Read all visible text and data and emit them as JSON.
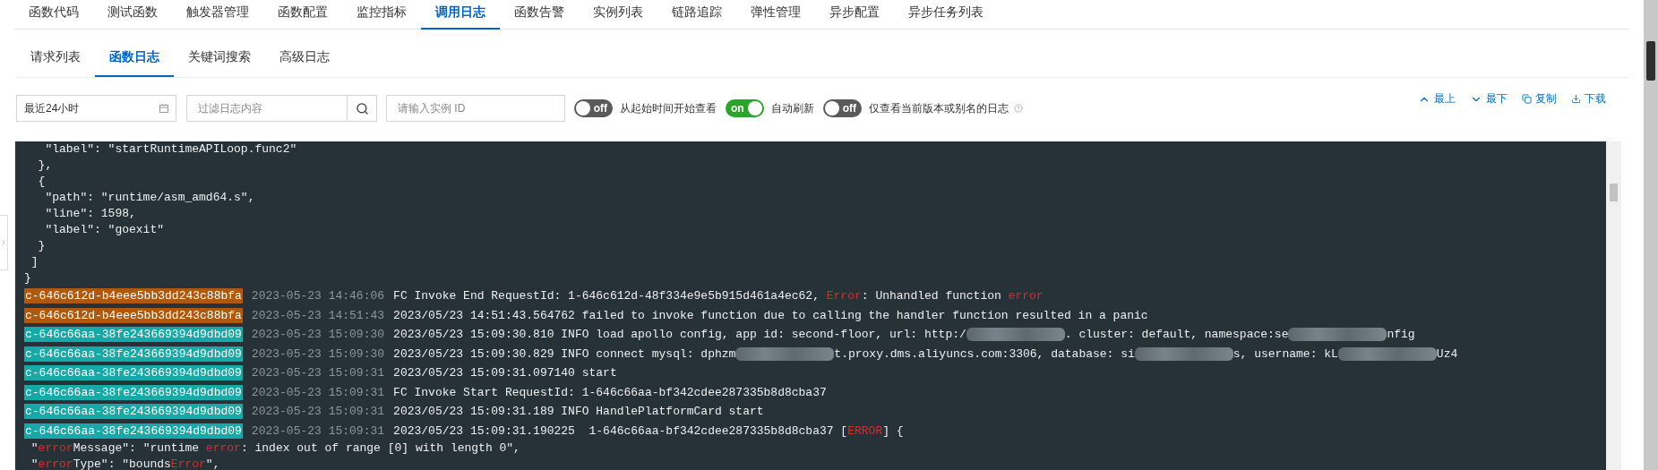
{
  "tabs": [
    {
      "label": "函数代码",
      "selected": false
    },
    {
      "label": "测试函数",
      "selected": false
    },
    {
      "label": "触发器管理",
      "selected": false
    },
    {
      "label": "函数配置",
      "selected": false
    },
    {
      "label": "监控指标",
      "selected": false
    },
    {
      "label": "调用日志",
      "selected": true
    },
    {
      "label": "函数告警",
      "selected": false
    },
    {
      "label": "实例列表",
      "selected": false
    },
    {
      "label": "链路追踪",
      "selected": false
    },
    {
      "label": "弹性管理",
      "selected": false
    },
    {
      "label": "异步配置",
      "selected": false
    },
    {
      "label": "异步任务列表",
      "selected": false
    }
  ],
  "sub_tabs": [
    {
      "label": "请求列表",
      "selected": false
    },
    {
      "label": "函数日志",
      "selected": true
    },
    {
      "label": "关键词搜索",
      "selected": false
    },
    {
      "label": "高级日志",
      "selected": false
    }
  ],
  "toolbar": {
    "time_range": "最近24小时",
    "filter": {
      "placeholder": "过滤日志内容"
    },
    "instance": {
      "placeholder": "请输入实例 ID"
    },
    "toggles": [
      {
        "text": "off",
        "on": false,
        "label": "从起始时间开始查看",
        "help": false
      },
      {
        "text": "on",
        "on": true,
        "label": "自动刷新",
        "help": false
      },
      {
        "text": "off",
        "on": false,
        "label": "仅查看当前版本或别名的日志",
        "help": true
      }
    ],
    "actions": [
      {
        "kind": "top",
        "label": "最上"
      },
      {
        "kind": "bottom",
        "label": "最下"
      },
      {
        "kind": "copy",
        "label": "复制"
      },
      {
        "kind": "download",
        "label": "下载"
      }
    ]
  },
  "log": [
    {
      "kind": "json",
      "parts": [
        {
          "kind": "text",
          "text": "   \"label\": \"startRuntimeAPILoop.func2\""
        }
      ]
    },
    {
      "kind": "json",
      "parts": [
        {
          "kind": "text",
          "text": "  },"
        }
      ]
    },
    {
      "kind": "json",
      "parts": [
        {
          "kind": "text",
          "text": "  {"
        }
      ]
    },
    {
      "kind": "json",
      "parts": [
        {
          "kind": "text",
          "text": "   \"path\": \"runtime/asm_amd64.s\","
        }
      ]
    },
    {
      "kind": "json",
      "parts": [
        {
          "kind": "text",
          "text": "   \"line\": 1598,"
        }
      ]
    },
    {
      "kind": "json",
      "parts": [
        {
          "kind": "text",
          "text": "   \"label\": \"goexit\""
        }
      ]
    },
    {
      "kind": "json",
      "parts": [
        {
          "kind": "text",
          "text": "  }"
        }
      ]
    },
    {
      "kind": "json",
      "parts": [
        {
          "kind": "text",
          "text": " ]"
        }
      ]
    },
    {
      "kind": "json",
      "parts": [
        {
          "kind": "text",
          "text": "}"
        }
      ]
    },
    {
      "kind": "entry",
      "instance": "c-646c612d-b4eee5bb3dd243c88bfa",
      "color": "#b0590c",
      "time": "2023-05-23 14:46:06",
      "parts": [
        {
          "kind": "text",
          "text": "FC Invoke End RequestId: 1-646c612d-48f334e9e5b915d461a4ec62, "
        },
        {
          "kind": "error",
          "text": "Error"
        },
        {
          "kind": "text",
          "text": ": Unhandled function "
        },
        {
          "kind": "error",
          "text": "error"
        }
      ]
    },
    {
      "kind": "entry",
      "instance": "c-646c612d-b4eee5bb3dd243c88bfa",
      "color": "#b0590c",
      "time": "2023-05-23 14:51:43",
      "parts": [
        {
          "kind": "text",
          "text": "2023/05/23 14:51:43.564762 failed to invoke function due to calling the handler function resulted in a panic"
        }
      ]
    },
    {
      "kind": "entry",
      "instance": "c-646c66aa-38fe243669394d9dbd09",
      "color": "#17a8a8",
      "time": "2023-05-23 15:09:30",
      "parts": [
        {
          "kind": "text",
          "text": "2023/05/23 15:09:30.810 INFO load apollo config, app id: second-floor, url: http:/"
        },
        {
          "kind": "redacted"
        },
        {
          "kind": "text",
          "text": ". cluster: default, namespace:se"
        },
        {
          "kind": "redacted"
        },
        {
          "kind": "text",
          "text": "nfig"
        }
      ]
    },
    {
      "kind": "entry",
      "instance": "c-646c66aa-38fe243669394d9dbd09",
      "color": "#17a8a8",
      "time": "2023-05-23 15:09:30",
      "parts": [
        {
          "kind": "text",
          "text": "2023/05/23 15:09:30.829 INFO connect mysql: dphzm"
        },
        {
          "kind": "redacted"
        },
        {
          "kind": "text",
          "text": "t.proxy.dms.aliyuncs.com:3306, database: si"
        },
        {
          "kind": "redacted"
        },
        {
          "kind": "text",
          "text": "s, username: kL"
        },
        {
          "kind": "redacted"
        },
        {
          "kind": "text",
          "text": "Uz4"
        }
      ]
    },
    {
      "kind": "entry",
      "instance": "c-646c66aa-38fe243669394d9dbd09",
      "color": "#17a8a8",
      "time": "2023-05-23 15:09:31",
      "parts": [
        {
          "kind": "text",
          "text": "2023/05/23 15:09:31.097140 start"
        }
      ]
    },
    {
      "kind": "entry",
      "instance": "c-646c66aa-38fe243669394d9dbd09",
      "color": "#17a8a8",
      "time": "2023-05-23 15:09:31",
      "parts": [
        {
          "kind": "text",
          "text": "FC Invoke Start RequestId: 1-646c66aa-bf342cdee287335b8d8cba37"
        }
      ]
    },
    {
      "kind": "entry",
      "instance": "c-646c66aa-38fe243669394d9dbd09",
      "color": "#17a8a8",
      "time": "2023-05-23 15:09:31",
      "parts": [
        {
          "kind": "text",
          "text": "2023/05/23 15:09:31.189 INFO HandlePlatformCard start"
        }
      ]
    },
    {
      "kind": "entry",
      "instance": "c-646c66aa-38fe243669394d9dbd09",
      "color": "#17a8a8",
      "time": "2023-05-23 15:09:31",
      "parts": [
        {
          "kind": "text",
          "text": "2023/05/23 15:09:31.190225  1-646c66aa-bf342cdee287335b8d8cba37 ["
        },
        {
          "kind": "error",
          "text": "ERROR"
        },
        {
          "kind": "text",
          "text": "] {"
        }
      ]
    },
    {
      "kind": "json",
      "parts": [
        {
          "kind": "text",
          "text": " \""
        },
        {
          "kind": "error",
          "text": "error"
        },
        {
          "kind": "text",
          "text": "Message\": \"runtime "
        },
        {
          "kind": "error",
          "text": "error"
        },
        {
          "kind": "text",
          "text": ": index out of range [0] with length 0\","
        }
      ]
    },
    {
      "kind": "json",
      "parts": [
        {
          "kind": "text",
          "text": " \""
        },
        {
          "kind": "error",
          "text": "error"
        },
        {
          "kind": "text",
          "text": "Type\": \"bounds"
        },
        {
          "kind": "error",
          "text": "Error"
        },
        {
          "kind": "text",
          "text": "\","
        }
      ]
    }
  ]
}
